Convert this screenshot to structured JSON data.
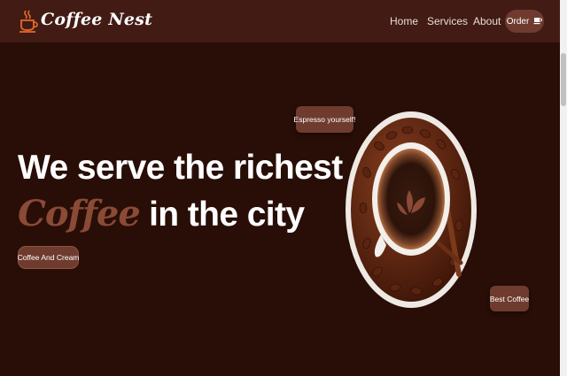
{
  "brand": {
    "name": "Coffee Nest",
    "logo_icon": "coffee-cup-icon"
  },
  "nav": {
    "links": [
      "Home",
      "Services",
      "About"
    ],
    "order_label": "Order",
    "order_icon": "coffee-cup-icon"
  },
  "hero": {
    "line1": "We serve the richest",
    "accent": "Coffee",
    "line2_rest": " in the city",
    "cta_label": "Coffee And Cream"
  },
  "tags": {
    "espresso": "Espresso yourself!",
    "best": "Best Coffee"
  },
  "colors": {
    "background": "#280e07",
    "navbar": "#421b15",
    "accent": "#8a4a36",
    "button": "#6f3b2e"
  }
}
